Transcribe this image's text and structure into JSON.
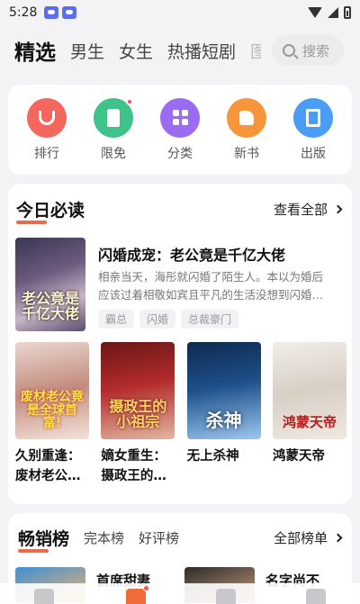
{
  "status_bar": {
    "time": "5:28"
  },
  "top_tabs": [
    "精选",
    "男生",
    "女生",
    "热播短剧",
    "图"
  ],
  "search": {
    "placeholder": "搜索"
  },
  "quick_links": [
    {
      "label": "排行",
      "icon": "trophy-icon",
      "color": "#f3675c",
      "badge": false
    },
    {
      "label": "限免",
      "icon": "price-tag-icon",
      "color": "#3fc38a",
      "badge": true
    },
    {
      "label": "分类",
      "icon": "category-grid-icon",
      "color": "#9a6cf2",
      "badge": false
    },
    {
      "label": "新书",
      "icon": "thumbs-up-icon",
      "color": "#f7953b",
      "badge": false
    },
    {
      "label": "出版",
      "icon": "book-icon",
      "color": "#4a9df2",
      "badge": false
    }
  ],
  "daily": {
    "title": "今日必读",
    "see_all": "查看全部",
    "featured": {
      "cover_text": "老公竟是千亿大佬",
      "title": "闪婚成宠：老公竟是千亿大佬",
      "description": "相亲当天，海彤就闪婚了陌生人。本以为婚后应该过着相敬如宾且平凡的生活没想到闪婚…",
      "tags": [
        "霸总",
        "闪婚",
        "总裁豪门"
      ]
    },
    "books": [
      {
        "cover_text": "废材老公竟是全球首富!",
        "title": "久别重逢：废材老公…"
      },
      {
        "cover_text": "摄政王的小祖宗",
        "title": "嫡女重生：摄政王的…"
      },
      {
        "cover_text": "杀神",
        "title": "无上杀神"
      },
      {
        "cover_text": "鸿蒙天帝",
        "title": "鸿蒙天帝"
      }
    ]
  },
  "bestseller": {
    "title": "畅销榜",
    "tabs": [
      "完本榜",
      "好评榜"
    ],
    "see_all": "全部榜单",
    "peek_titles": [
      "首席甜妻",
      "名字尚不"
    ]
  },
  "colors": {
    "accent": "#f06a4a",
    "card_bg": "#ffffff",
    "page_bg": "#f3f3f5"
  }
}
